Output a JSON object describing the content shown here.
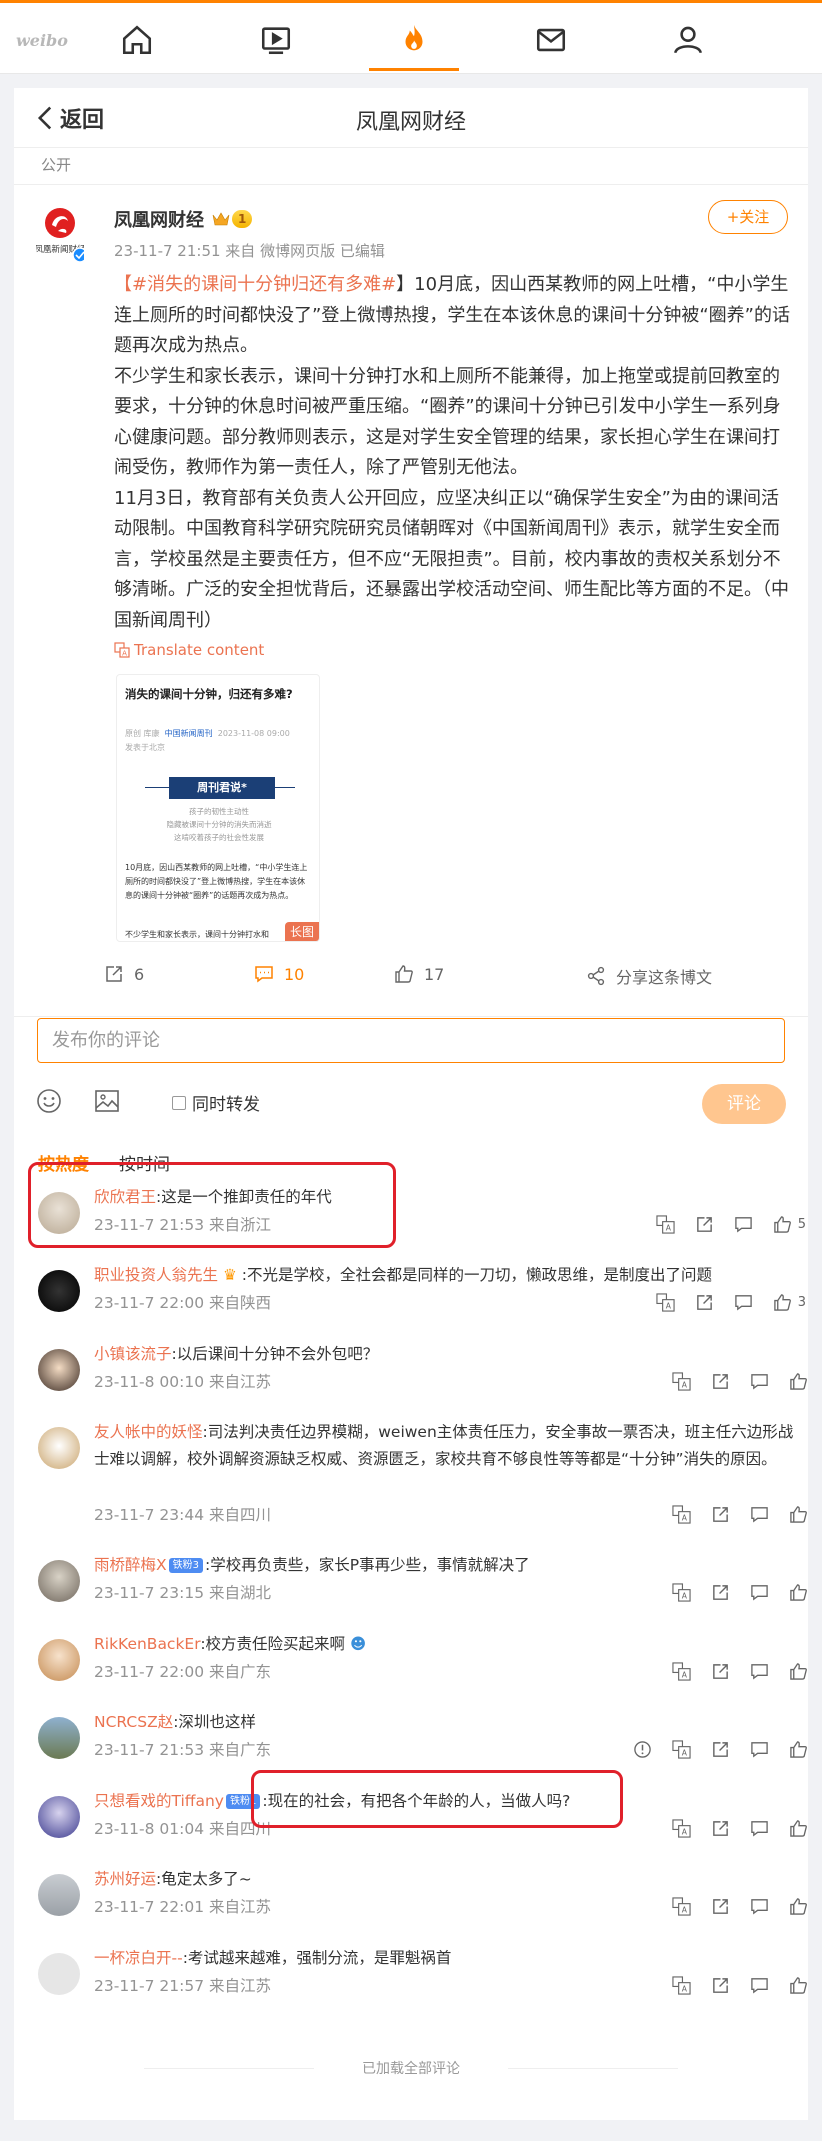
{
  "topbar": {
    "logo": "weibo"
  },
  "header": {
    "back_label": "返回",
    "title": "凤凰网财经"
  },
  "visibility": "公开",
  "post": {
    "author": "凤凰网财经",
    "level": "1",
    "avatar_text": "凤凰新闻财经",
    "meta": "23-11-7 21:51  来自 微博网页版 已编辑",
    "follow_label": "+关注",
    "tag_open": "【",
    "tag": "#消失的课间十分钟归还有多难#",
    "tag_close": "】",
    "para1": "10月底，因山西某教师的网上吐槽，“中小学生连上厕所的时间都快没了”登上微博热搜，学生在本该休息的课间十分钟被“圈养”的话题再次成为热点。",
    "para2": "不少学生和家长表示，课间十分钟打水和上厕所不能兼得，加上拖堂或提前回教室的要求，十分钟的休息时间被严重压缩。“圈养”的课间十分钟已引发中小学生一系列身心健康问题。部分教师则表示，这是对学生安全管理的结果，家长担心学生在课间打闹受伤，教师作为第一责任人，除了严管别无他法。",
    "para3": "11月3日，教育部有关负责人公开回应，应坚决纠正以“确保学生安全”为由的课间活动限制。中国教育科学研究院研究员储朝晖对《中国新闻周刊》表示，就学生安全而言，学校虽然是主要责任方，但不应“无限担责”。目前，校内事故的责权关系划分不够清晰。广泛的安全担忧背后，还暴露出学校活动空间、师生配比等方面的不足。（中国新闻周刊）",
    "translate_label": "Translate content",
    "preview": {
      "title": "消失的课间十分钟，归还有多难?",
      "meta_a": "原创  库康",
      "meta_b": "中国新闻周刊",
      "meta_c": "2023-11-08 09:00",
      "meta_d": "发表于北京",
      "box": "周刊君说*",
      "sub1": "孩子的韧性主动性",
      "sub2": "隐藏被课间十分钟的消失而消逝",
      "sub3": "这啃咬着孩子的社会性发展",
      "text": "10月底，因山西某教师的网上吐槽，“中小学生连上厕所的时间都快没了”登上微博热搜，学生在本该休息的课间十分钟被“圈养”的话题再次成为热点。",
      "text2": "不少学生和家长表示，课间十分钟打水和",
      "badge": "长图"
    },
    "stats": {
      "repost": "6",
      "comment": "10",
      "like": "17",
      "share": "分享这条博文"
    }
  },
  "composer": {
    "placeholder": "发布你的评论",
    "forward_label": "同时转发",
    "submit_label": "评论"
  },
  "sort": {
    "hot": "按热度",
    "time": "按时间"
  },
  "comments": [
    {
      "name": "欣欣君王",
      "text": ":这是一个推卸责任的年代",
      "time": "23-11-7 21:53 来自浙江",
      "likes": "5"
    },
    {
      "name": "职业投资人翁先生",
      "text": " :不光是学校，全社会都是同样的一刀切，懒政思维，是制度出了问题",
      "time": "23-11-7 22:00 来自陕西",
      "likes": "3"
    },
    {
      "name": "小镇该流子",
      "text": ":以后课间十分钟不会外包吧？",
      "time": "23-11-8 00:10 来自江苏",
      "likes": ""
    },
    {
      "name": "友人帐中的妖怪",
      "text": ":司法判决责任边界模糊，weiwen主体责任压力，安全事故一票否决，班主任六边形战士难以调解，校外调解资源缺乏权威、资源匮乏，家校共育不够良性等等都是“十分钟”消失的原因。",
      "time": "23-11-7 23:44 来自四川",
      "likes": ""
    },
    {
      "name": "雨桥醉梅X",
      "badge": "铁粉3",
      "text": ":学校再负责些，家长P事再少些，事情就解决了",
      "time": "23-11-7 23:15 来自湖北",
      "likes": ""
    },
    {
      "name": "RikKenBackEr",
      "text": ":校方责任险买起来啊",
      "time": "23-11-7 22:00 来自广东",
      "likes": ""
    },
    {
      "name": "NCRCSZ赵",
      "text": ":深圳也这样",
      "time": "23-11-7 21:53 来自广东",
      "likes": ""
    },
    {
      "name": "只想看戏的Tiffany",
      "badge": "铁粉1",
      "text": ":现在的社会，有把各个年龄的人，当做人吗?",
      "time": "23-11-8 01:04 来自四川",
      "likes": ""
    },
    {
      "name": "苏州好运",
      "text": ":龟定太多了~",
      "time": "23-11-7 22:01 来自江苏",
      "likes": ""
    },
    {
      "name": "一杯凉白开--",
      "text": ":考试越来越难，强制分流，是罪魁祸首",
      "time": "23-11-7 21:57 来自江苏",
      "likes": ""
    }
  ],
  "footer": {
    "loaded_all": "已加载全部评论"
  },
  "colors": {
    "accent": "#ff8200",
    "link": "#eb7350",
    "highlight": "#e0202a"
  }
}
